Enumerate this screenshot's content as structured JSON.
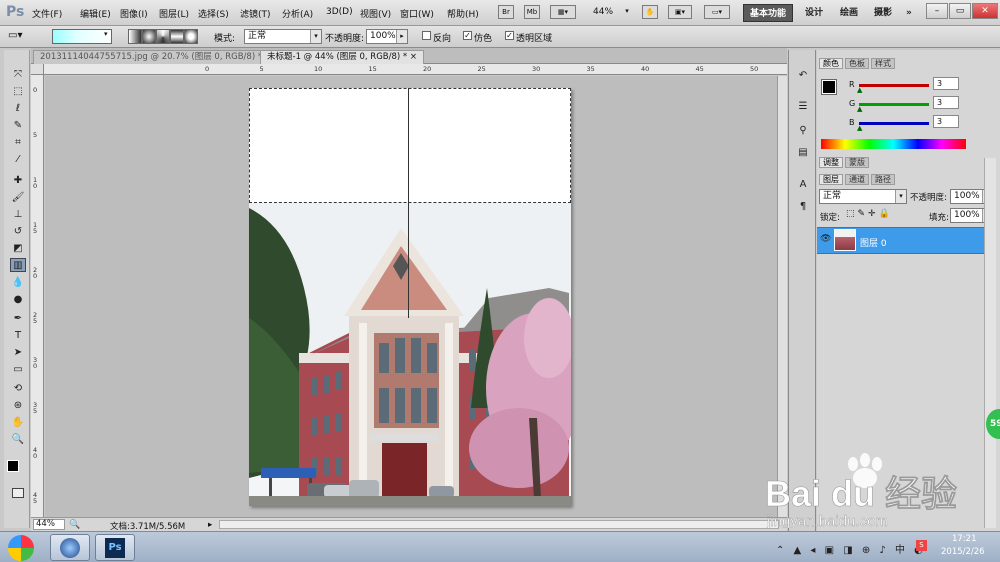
{
  "app": {
    "logo": "Ps"
  },
  "menu": [
    "文件(F)",
    "编辑(E)",
    "图像(I)",
    "图层(L)",
    "选择(S)",
    "滤镜(T)",
    "分析(A)",
    "3D(D)",
    "视图(V)",
    "窗口(W)",
    "帮助(H)"
  ],
  "menubar_icons": [
    "Br",
    "Mb"
  ],
  "zoom": "44%",
  "workspaces": {
    "essentials": "基本功能",
    "design": "设计",
    "painting": "绘画",
    "photography": "摄影",
    "more": "»"
  },
  "options": {
    "mode_label": "模式:",
    "mode_value": "正常",
    "opacity_label": "不透明度:",
    "opacity_value": "100%",
    "reverse": "反向",
    "dither": "仿色",
    "transparency": "透明区域",
    "reverse_checked": false,
    "dither_checked": true,
    "transparency_checked": true
  },
  "tabs": [
    {
      "label": "20131114044755715.jpg @ 20.7% (图层 0, RGB/8) *  ×",
      "active": false
    },
    {
      "label": "未标题-1 @ 44% (图层 0, RGB/8) *  ×",
      "active": true
    }
  ],
  "ruler_top": [
    "0",
    "5",
    "10",
    "15",
    "20",
    "25",
    "30",
    "35",
    "40",
    "45",
    "50",
    "55"
  ],
  "ruler_left": [
    "0",
    "5",
    "1\n0",
    "1\n5",
    "2\n0",
    "2\n5",
    "3\n0",
    "3\n5",
    "4\n0",
    "4\n5"
  ],
  "status": {
    "zoom": "44%",
    "doc": "文档:3.71M/5.56M"
  },
  "color_panel": {
    "tabs": [
      "颜色",
      "色板",
      "样式"
    ],
    "channels": [
      {
        "label": "R",
        "value": "3",
        "color": "#c00000"
      },
      {
        "label": "G",
        "value": "3",
        "color": "#00a000"
      },
      {
        "label": "B",
        "value": "3",
        "color": "#0000c0"
      }
    ]
  },
  "adjust_tabs": [
    "调整",
    "蒙版"
  ],
  "layers_panel": {
    "tabs": [
      "图层",
      "通道",
      "路径"
    ],
    "blend": "正常",
    "opacity_label": "不透明度:",
    "opacity": "100%",
    "lock_label": "锁定:",
    "fill_label": "填充:",
    "fill": "100%",
    "layers": [
      {
        "name": "图层 0"
      }
    ]
  },
  "taskbar": {
    "time": "17:21",
    "date": "2015/2/26",
    "app_ps": "Ps"
  },
  "badge": "59",
  "watermark": {
    "brand": "Bai du 经验",
    "url": "jingyan.baidu.com"
  }
}
